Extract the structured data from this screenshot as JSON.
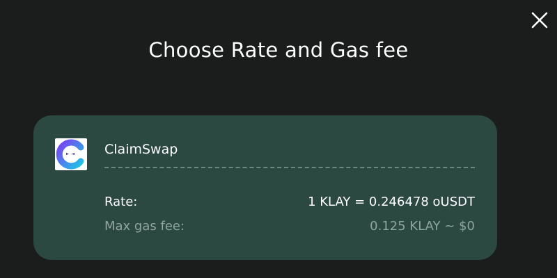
{
  "modal": {
    "title": "Choose Rate and Gas fee",
    "close_icon": "close-icon"
  },
  "provider": {
    "name": "ClaimSwap",
    "logo_icon": "claimswap-logo-icon",
    "rate_label": "Rate:",
    "rate_value": "1 KLAY = 0.246478 oUSDT",
    "gas_label": "Max gas fee:",
    "gas_value": "0.125 KLAY ~ $0"
  },
  "colors": {
    "background": "#1b1d1c",
    "card": "#2b4841",
    "muted_text": "#8fa6a0",
    "logo_purple": "#7b3ff2",
    "logo_cyan": "#1fc3e8"
  }
}
